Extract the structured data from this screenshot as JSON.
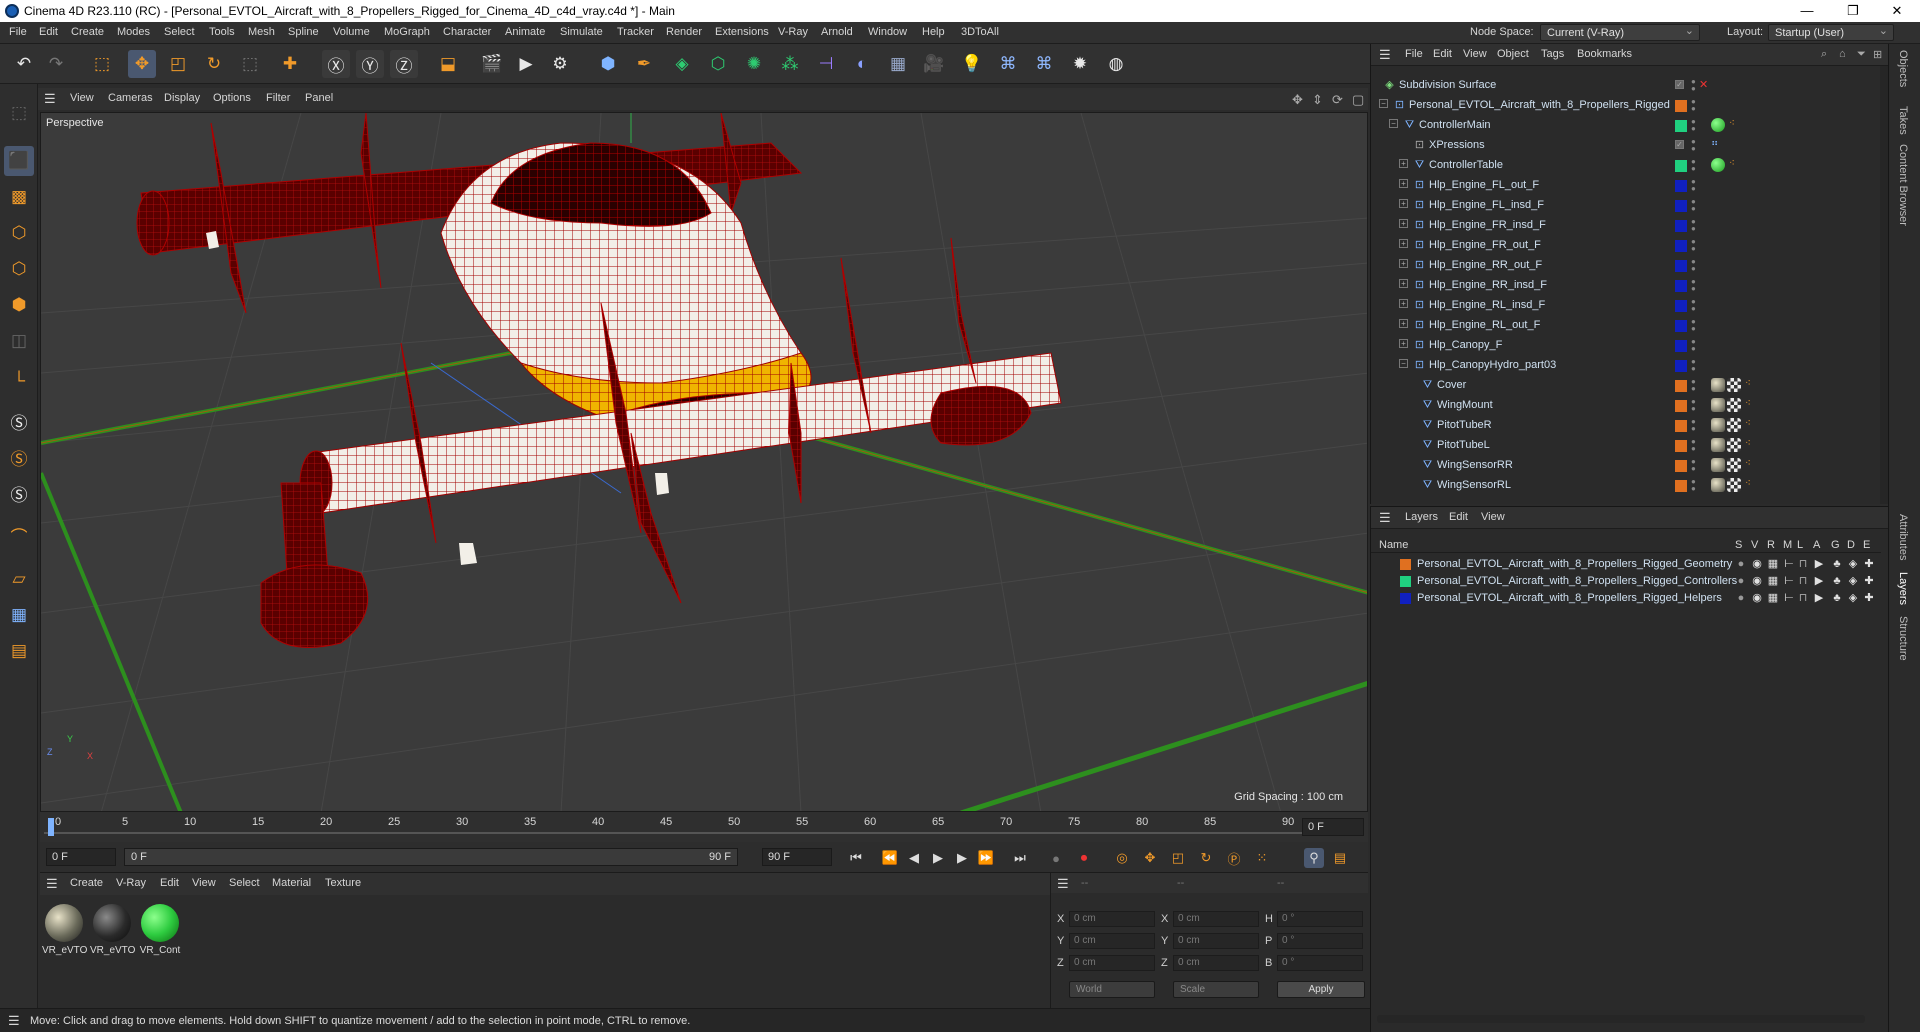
{
  "window": {
    "title": "Cinema 4D R23.110 (RC) - [Personal_EVTOL_Aircraft_with_8_Propellers_Rigged_for_Cinema_4D_c4d_vray.c4d *] - Main",
    "minimize": "—",
    "maximize": "❐",
    "close": "✕"
  },
  "menubar": {
    "items": [
      "File",
      "Edit",
      "Create",
      "Modes",
      "Select",
      "Tools",
      "Mesh",
      "Spline",
      "Volume",
      "MoGraph",
      "Character",
      "Animate",
      "Simulate",
      "Tracker",
      "Render",
      "Extensions",
      "V-Ray",
      "Arnold",
      "Window",
      "Help",
      "3DToAll"
    ],
    "node_space_label": "Node Space:",
    "node_space_value": "Current (V-Ray)",
    "layout_label": "Layout:",
    "layout_value": "Startup (User)"
  },
  "viewport": {
    "menu": [
      "View",
      "Cameras",
      "Display",
      "Options",
      "Filter",
      "Panel"
    ],
    "label": "Perspective",
    "grid_spacing": "Grid Spacing : 100 cm",
    "axis_x": "X",
    "axis_y": "Y",
    "axis_z": "Z"
  },
  "timeline": {
    "ticks": [
      "0",
      "5",
      "10",
      "15",
      "20",
      "25",
      "30",
      "35",
      "40",
      "45",
      "50",
      "55",
      "60",
      "65",
      "70",
      "75",
      "80",
      "85",
      "90"
    ],
    "current_frame": "0 F"
  },
  "playbar": {
    "start": "0 F",
    "range_start": "0 F",
    "range_end": "90 F",
    "end": "90 F"
  },
  "material_panel": {
    "menu": [
      "Create",
      "V-Ray",
      "Edit",
      "View",
      "Select",
      "Material",
      "Texture"
    ],
    "materials": [
      {
        "name": "VR_eVTO",
        "color": "#8a8a7c"
      },
      {
        "name": "VR_eVTO",
        "color": "#2a2a2a"
      },
      {
        "name": "VR_Cont",
        "color": "#2ecc40"
      }
    ]
  },
  "coord_panel": {
    "header": [
      "--",
      "--",
      "--"
    ],
    "rows": [
      {
        "a": "X",
        "av": "0 cm",
        "b": "X",
        "bv": "0 cm",
        "c": "H",
        "cv": "0 °"
      },
      {
        "a": "Y",
        "av": "0 cm",
        "b": "Y",
        "bv": "0 cm",
        "c": "P",
        "cv": "0 °"
      },
      {
        "a": "Z",
        "av": "0 cm",
        "b": "Z",
        "bv": "0 cm",
        "c": "B",
        "cv": "0 °"
      }
    ],
    "space": "World",
    "mode": "Scale",
    "apply": "Apply"
  },
  "status": {
    "text": "Move: Click and drag to move elements. Hold down SHIFT to quantize movement / add to the selection in point mode, CTRL to remove."
  },
  "object_manager": {
    "menu": [
      "File",
      "Edit",
      "View",
      "Object",
      "Tags",
      "Bookmarks"
    ],
    "objects": [
      {
        "name": "Subdivision Surface",
        "depth": 0,
        "layer": "#888888",
        "tags": ""
      },
      {
        "name": "Personal_EVTOL_Aircraft_with_8_Propellers_Rigged",
        "depth": 1,
        "layer": "#e07020",
        "tags": ""
      },
      {
        "name": "ControllerMain",
        "depth": 2,
        "layer": "#20d080",
        "tags": "green"
      },
      {
        "name": "XPressions",
        "depth": 3,
        "layer": "#888888",
        "tags": "xp"
      },
      {
        "name": "ControllerTable",
        "depth": 3,
        "layer": "#20d080",
        "tags": "green"
      },
      {
        "name": "Hlp_Engine_FL_out_F",
        "depth": 3,
        "layer": "#1020c0",
        "tags": ""
      },
      {
        "name": "Hlp_Engine_FL_insd_F",
        "depth": 3,
        "layer": "#1020c0",
        "tags": ""
      },
      {
        "name": "Hlp_Engine_FR_insd_F",
        "depth": 3,
        "layer": "#1020c0",
        "tags": ""
      },
      {
        "name": "Hlp_Engine_FR_out_F",
        "depth": 3,
        "layer": "#1020c0",
        "tags": ""
      },
      {
        "name": "Hlp_Engine_RR_out_F",
        "depth": 3,
        "layer": "#1020c0",
        "tags": ""
      },
      {
        "name": "Hlp_Engine_RR_insd_F",
        "depth": 3,
        "layer": "#1020c0",
        "tags": ""
      },
      {
        "name": "Hlp_Engine_RL_insd_F",
        "depth": 3,
        "layer": "#1020c0",
        "tags": ""
      },
      {
        "name": "Hlp_Engine_RL_out_F",
        "depth": 3,
        "layer": "#1020c0",
        "tags": ""
      },
      {
        "name": "Hlp_Canopy_F",
        "depth": 3,
        "layer": "#1020c0",
        "tags": ""
      },
      {
        "name": "Hlp_CanopyHydro_part03",
        "depth": 3,
        "layer": "#1020c0",
        "tags": ""
      },
      {
        "name": "Cover",
        "depth": 4,
        "layer": "#e07020",
        "tags": "mat"
      },
      {
        "name": "WingMount",
        "depth": 4,
        "layer": "#e07020",
        "tags": "mat"
      },
      {
        "name": "PitotTubeR",
        "depth": 4,
        "layer": "#e07020",
        "tags": "mat"
      },
      {
        "name": "PitotTubeL",
        "depth": 4,
        "layer": "#e07020",
        "tags": "mat"
      },
      {
        "name": "WingSensorRR",
        "depth": 4,
        "layer": "#e07020",
        "tags": "mat"
      },
      {
        "name": "WingSensorRL",
        "depth": 4,
        "layer": "#e07020",
        "tags": "mat"
      }
    ]
  },
  "layer_manager": {
    "menu": [
      "Layers",
      "Edit",
      "View"
    ],
    "col_name": "Name",
    "cols": [
      "S",
      "V",
      "R",
      "M",
      "L",
      "A",
      "G",
      "D",
      "E"
    ],
    "layers": [
      {
        "name": "Personal_EVTOL_Aircraft_with_8_Propellers_Rigged_Geometry",
        "color": "#e07020"
      },
      {
        "name": "Personal_EVTOL_Aircraft_with_8_Propellers_Rigged_Controllers",
        "color": "#20d080"
      },
      {
        "name": "Personal_EVTOL_Aircraft_with_8_Propellers_Rigged_Helpers",
        "color": "#1020c0"
      }
    ]
  },
  "right_tabs": [
    "Objects",
    "Takes",
    "Content Browser",
    "Attributes",
    "Layers",
    "Structure"
  ]
}
